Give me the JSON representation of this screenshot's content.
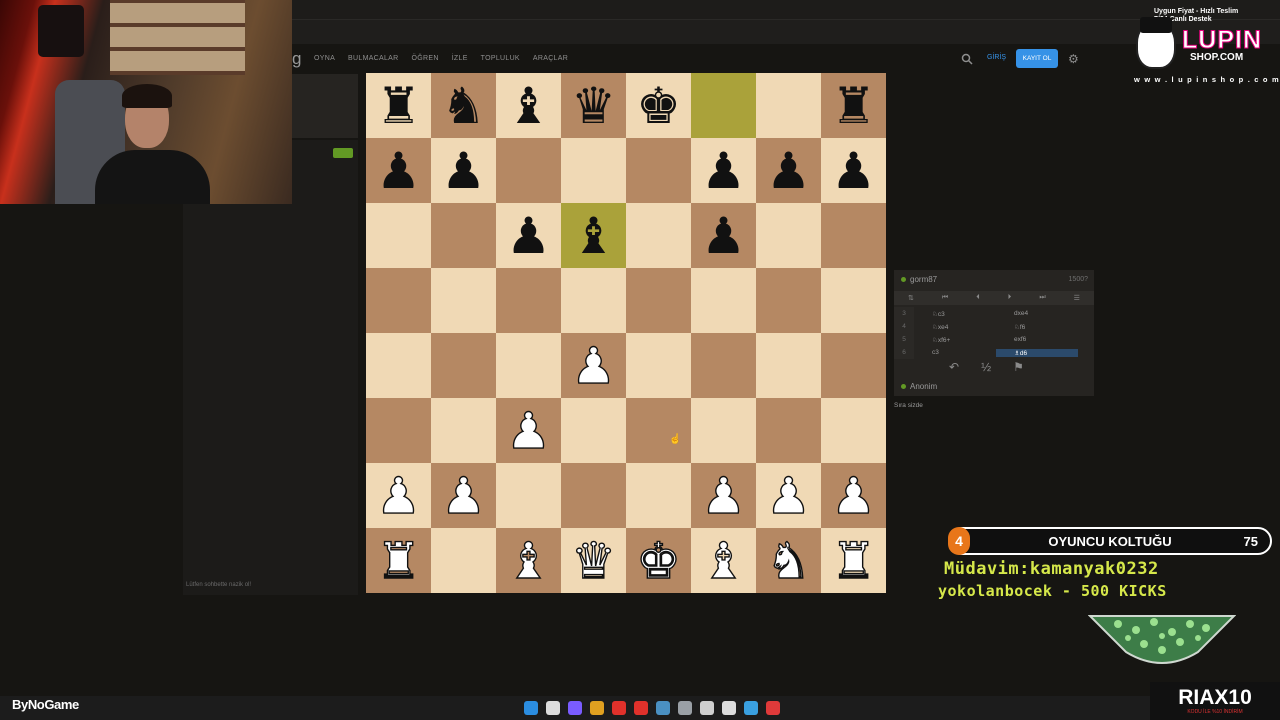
{
  "site": {
    "logo_letter": "g",
    "menu": [
      "OYNA",
      "BULMACALAR",
      "ÖĞREN",
      "İZLE",
      "TOPLULUK",
      "ARAÇLAR"
    ],
    "login_label": "GİRİŞ",
    "signup_label": "KAYIT OL"
  },
  "chat": {
    "placeholder": "Lütfen sohbette nazik ol!"
  },
  "board": {
    "orientation": "white",
    "ranks": [
      [
        "r",
        "n",
        "b",
        "q",
        "k",
        "",
        "",
        "r"
      ],
      [
        "p",
        "p",
        "",
        "",
        "",
        "p",
        "p",
        "p"
      ],
      [
        "",
        "",
        "p",
        "b",
        "",
        "p",
        "",
        ""
      ],
      [
        "",
        "",
        "",
        "",
        "",
        "",
        "",
        ""
      ],
      [
        "",
        "",
        "",
        "P",
        "",
        "",
        "",
        ""
      ],
      [
        "",
        "",
        "P",
        "",
        "",
        "",
        "",
        ""
      ],
      [
        "P",
        "P",
        "",
        "",
        "",
        "P",
        "P",
        "P"
      ],
      [
        "R",
        "",
        "B",
        "Q",
        "K",
        "B",
        "N",
        "R"
      ]
    ],
    "highlighted_squares": [
      "f8",
      "d6"
    ],
    "colors": {
      "light": "#f0d9b5",
      "dark": "#b58863",
      "highlight": "#aaa23a"
    }
  },
  "game": {
    "opponent": "gorm87",
    "opponent_rating": "1500?",
    "player": "Anonim",
    "turn_text": "Sıra sizde",
    "moves": [
      {
        "n": "3",
        "white": "♘c3",
        "black": "dxe4"
      },
      {
        "n": "4",
        "white": "♘xe4",
        "black": "♘f6"
      },
      {
        "n": "5",
        "white": "♘xf6+",
        "black": "exf6"
      },
      {
        "n": "6",
        "white": "c3",
        "black": "♗d6"
      }
    ],
    "draw_label": "½"
  },
  "sponsor": {
    "top_line1": "Uygun Fiyat - Hızlı Teslim",
    "top_line2": "7/24 Canlı Destek",
    "title": "LUPIN",
    "subtitle": "SHOP.COM",
    "url": "w w w . l u p i n s h o p . c o m"
  },
  "alert": {
    "badge": "4",
    "title": "OYUNCU KOLTUĞU",
    "count": "75"
  },
  "ticker": {
    "line1": "Müdavim:kamanyak0232",
    "line2": "yokolanbocek - 500 KICKS"
  },
  "footer": {
    "brand": "ByNoGame",
    "riax_title": "RIAX10",
    "riax_sub": "KODU İLE %10 İNDİRİM"
  },
  "taskbar_icons": [
    "windows-icon",
    "search-icon",
    "chat-icon",
    "chrome-icon",
    "opera-icon",
    "app-icon",
    "steam-icon",
    "stream-icon",
    "calculator-icon",
    "back-icon",
    "globe-icon",
    "record-icon"
  ]
}
